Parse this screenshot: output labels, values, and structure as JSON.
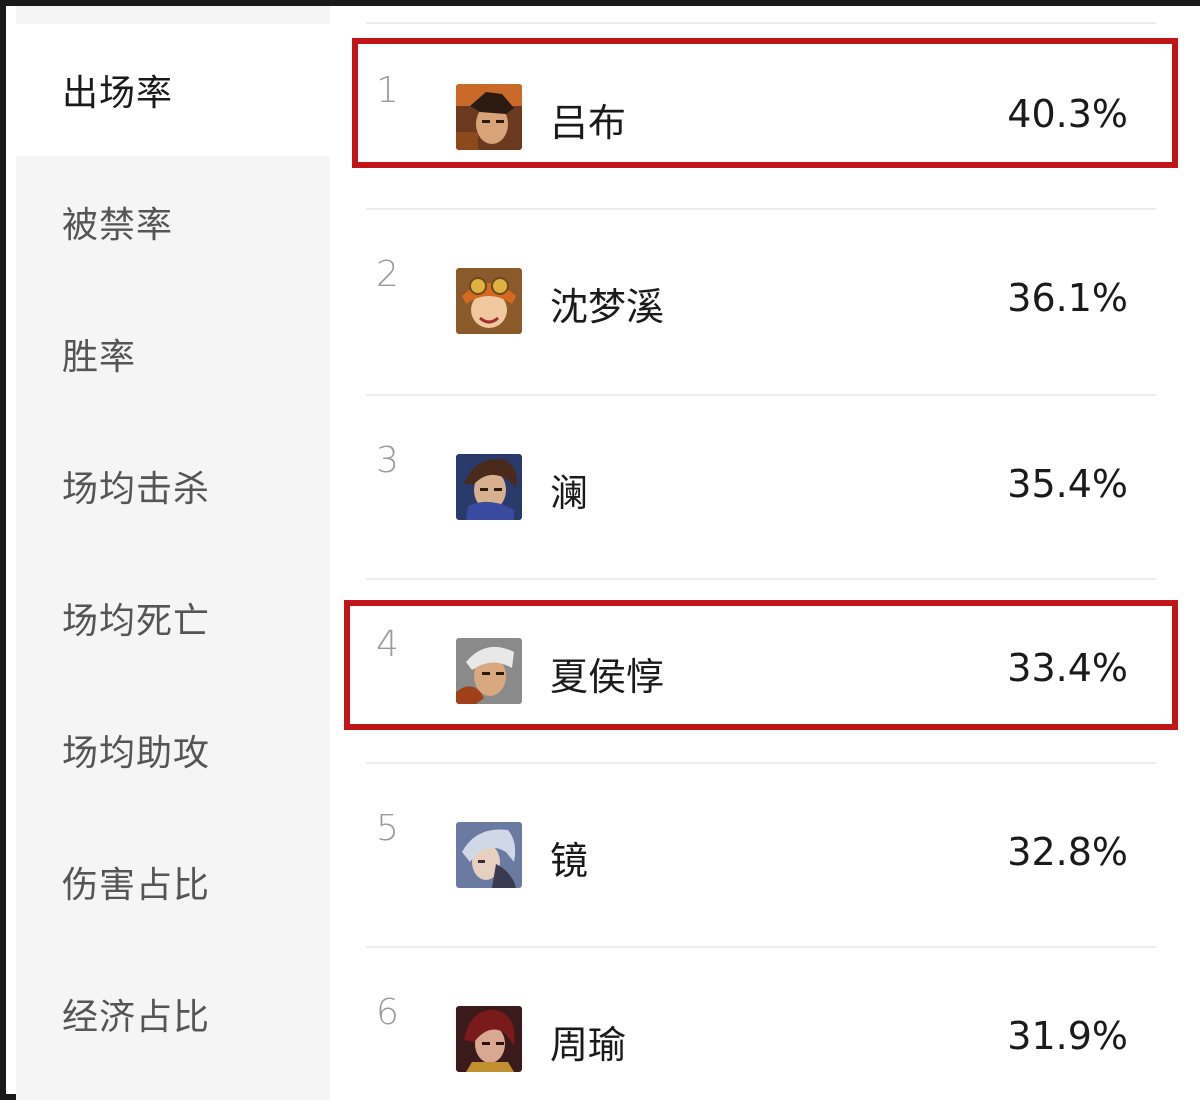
{
  "sidebar": {
    "items": [
      {
        "label": "出场率",
        "active": true
      },
      {
        "label": "被禁率"
      },
      {
        "label": "胜率"
      },
      {
        "label": "场均击杀"
      },
      {
        "label": "场均死亡"
      },
      {
        "label": "场均助攻"
      },
      {
        "label": "伤害占比"
      },
      {
        "label": "经济占比"
      }
    ]
  },
  "ranking": {
    "rows": [
      {
        "rank": "1",
        "name": "吕布",
        "value": "40.3%",
        "avatar": "hero-avatar-lvbu",
        "highlighted": true
      },
      {
        "rank": "2",
        "name": "沈梦溪",
        "value": "36.1%",
        "avatar": "hero-avatar-shenmengxi"
      },
      {
        "rank": "3",
        "name": "澜",
        "value": "35.4%",
        "avatar": "hero-avatar-lan"
      },
      {
        "rank": "4",
        "name": "夏侯惇",
        "value": "33.4%",
        "avatar": "hero-avatar-xiahoudun",
        "highlighted": true
      },
      {
        "rank": "5",
        "name": "镜",
        "value": "32.8%",
        "avatar": "hero-avatar-jing"
      },
      {
        "rank": "6",
        "name": "周瑜",
        "value": "31.9%",
        "avatar": "hero-avatar-zhouyu"
      }
    ]
  },
  "colors": {
    "highlight": "#c0161a",
    "sidebar_bg": "#f5f5f5",
    "active_bg": "#ffffff"
  }
}
